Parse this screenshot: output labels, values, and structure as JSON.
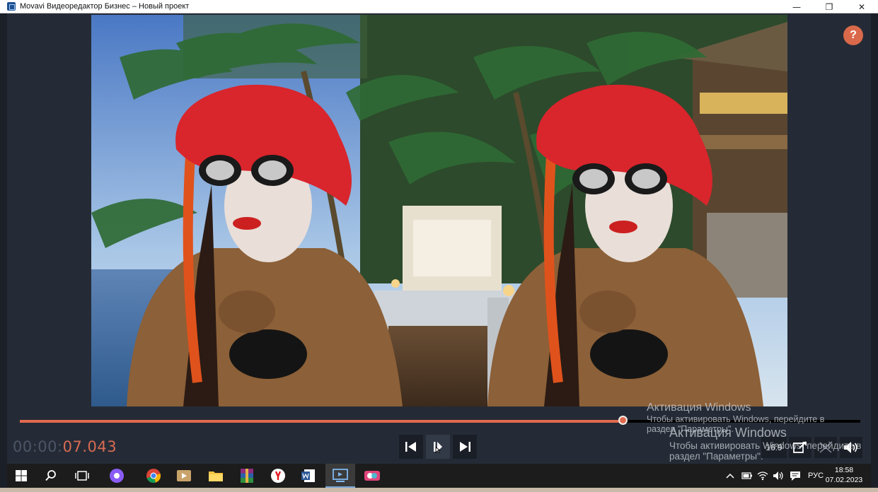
{
  "window": {
    "title": "Movavi Видеоредактор Бизнес – Новый проект",
    "minimize": "—",
    "restore": "❐",
    "close": "✕"
  },
  "player": {
    "help_label": "?",
    "timecode_dim": "00:00:",
    "timecode_highlight": "07.043",
    "progress": 0.717,
    "aspect_label": "16:9",
    "buttons": {
      "prev_icon": "skip-back-icon",
      "play_pause_icon": "play-pause-icon",
      "next_icon": "skip-forward-icon",
      "snapshot_icon": "snapshot-icon",
      "fullscreen_icon": "fullscreen-icon",
      "volume_icon": "volume-icon"
    }
  },
  "watermark": {
    "title": "Активация Windows",
    "line1": "Чтобы активировать Windows, перейдите в",
    "line2": "раздел \"Параметры\"."
  },
  "taskbar": {
    "apps": [
      "start-icon",
      "search-icon",
      "task-view-icon",
      "alice-icon",
      "chrome-icon",
      "media-player-icon",
      "file-explorer-icon",
      "winrar-icon",
      "yandex-browser-icon",
      "word-icon",
      "movavi-icon",
      "photo-app-icon"
    ],
    "language": "РУС",
    "time": "18:58",
    "date": "07.02.2023"
  },
  "colors": {
    "accent": "#e06a50",
    "app_bg": "#252b36",
    "button_bg": "#1a1e26",
    "help": "#d9694a"
  }
}
